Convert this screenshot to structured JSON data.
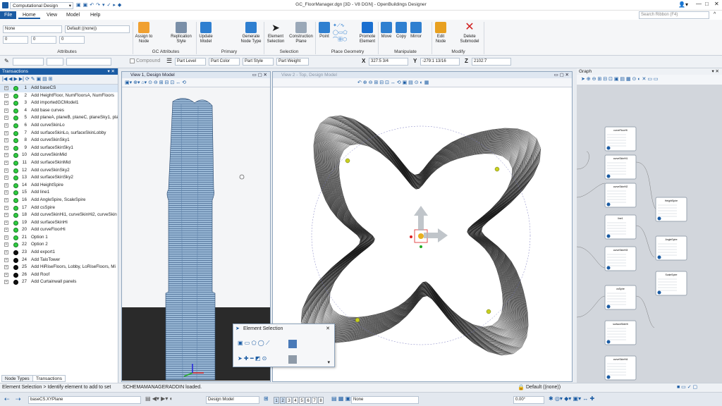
{
  "app": {
    "workspace": "Computational Design",
    "window_title": "GC_FloorManager.dgn [3D - V8 DGN] - OpenBuildings Designer",
    "search_placeholder": "Search Ribbon (F4)"
  },
  "menu": [
    "File",
    "Home",
    "View",
    "Model",
    "Help"
  ],
  "ribbon": {
    "attributes": {
      "level": "None",
      "style": "Default ((none))",
      "color": "0",
      "weight": "0",
      "linestyle": "0",
      "label": "Attributes"
    },
    "gc_attributes": {
      "assign": "Assign to Node",
      "replication": "Replication Style",
      "label": "GC Attributes"
    },
    "primary": {
      "update": "Update Model",
      "generate": "Generate Node Type",
      "label": "Primary"
    },
    "selection": {
      "element": "Element Selection",
      "construction": "Construction Plane",
      "label": "Selection"
    },
    "place_geometry": {
      "point": "Point",
      "promote": "Promote Element",
      "label": "Place Geometry"
    },
    "manipulate": {
      "move": "Move",
      "copy": "Copy",
      "mirror": "Mirror",
      "label": "Manipulate"
    },
    "modify": {
      "edit": "Edit Node",
      "delete": "Delete Submodel",
      "label": "Modify"
    }
  },
  "toolbar2": {
    "compound": "Compound",
    "part_level": "Part Level",
    "part_color": "Part Color",
    "part_style": "Part Style",
    "part_weight": "Part Weight",
    "x_label": "X",
    "x_value": "327:5 3/4",
    "y_label": "Y",
    "y_value": "-279:1 13/16",
    "z_label": "Z",
    "z_value": "2102:7"
  },
  "transactions": {
    "title": "Transactions",
    "rows": [
      {
        "n": "1",
        "t": "Add baseCS",
        "s": "g"
      },
      {
        "n": "2",
        "t": "Add HeightFloor, NumFloorsA, NumFloors",
        "s": "g"
      },
      {
        "n": "3",
        "t": "Add importedGCModel1",
        "s": "g"
      },
      {
        "n": "4",
        "t": "Add base curves",
        "s": "g"
      },
      {
        "n": "5",
        "t": "Add planeA, planeB, planeC, planeSky1, pla",
        "s": "g"
      },
      {
        "n": "6",
        "t": "Add curveSkinLo",
        "s": "g"
      },
      {
        "n": "7",
        "t": "Add surfaceSkinLo, surfaceSkinLobby",
        "s": "g"
      },
      {
        "n": "8",
        "t": "Add curveSkinSky1",
        "s": "g"
      },
      {
        "n": "9",
        "t": "Add surfaceSkinSky1",
        "s": "g"
      },
      {
        "n": "10",
        "t": "Add curveSkinMid",
        "s": "g"
      },
      {
        "n": "11",
        "t": "Add surfaceSkinMid",
        "s": "g"
      },
      {
        "n": "12",
        "t": "Add curveSkinSky2",
        "s": "g"
      },
      {
        "n": "13",
        "t": "Add surfaceSkinSky2",
        "s": "g"
      },
      {
        "n": "14",
        "t": "Add HeightSpire",
        "s": "g"
      },
      {
        "n": "15",
        "t": "Add line1",
        "s": "g"
      },
      {
        "n": "16",
        "t": "Add AngleSpire, ScaleSpire",
        "s": "g"
      },
      {
        "n": "17",
        "t": "Add csSpire",
        "s": "g"
      },
      {
        "n": "18",
        "t": "Add curveSkinHi1, curveSkinHi2, curveSkin",
        "s": "g"
      },
      {
        "n": "19",
        "t": "Add surfaceSkinHi",
        "s": "g"
      },
      {
        "n": "20",
        "t": "Add curveFloorHi",
        "s": "g"
      },
      {
        "n": "21",
        "t": "Option 1",
        "s": "g"
      },
      {
        "n": "22",
        "t": "Option 2",
        "s": "g"
      },
      {
        "n": "23",
        "t": "Add export1",
        "s": "b"
      },
      {
        "n": "24",
        "t": "Add TaloTower",
        "s": "b"
      },
      {
        "n": "25",
        "t": "Add HiRiseFloors, Lobby, LoRiseFloors, Mi",
        "s": "b"
      },
      {
        "n": "26",
        "t": "Add Roof",
        "s": "b"
      },
      {
        "n": "27",
        "t": "Add Curtainwall panels",
        "s": "b"
      }
    ],
    "tabs": [
      "Node Types",
      "Transactions"
    ]
  },
  "views": {
    "v1": "View 1, Design Model",
    "v2": "View 2 - Top, Design Model"
  },
  "graph": {
    "title": "Graph",
    "nodes": [
      "curveFloorHi",
      "curveSkinHi1",
      "curveSkinHi2",
      "HeightSpire",
      "line1",
      "AngleSpire",
      "curveSkinHi3",
      "ScaleSpire",
      "csSpire",
      "surfaceSkinHi",
      "curveSkinHi4"
    ]
  },
  "element_selection": {
    "title": "Element Selection"
  },
  "status": {
    "prompt": "Element Selection > Identify element to add to set",
    "message": "SCHEMAMANAGERADDIN loaded.",
    "style": "Default ((none))"
  },
  "bottom": {
    "acs": "baseCS.XYPlane",
    "model": "Design Model",
    "views": [
      "1",
      "2",
      "3",
      "4",
      "5",
      "6",
      "7",
      "8"
    ],
    "level": "None",
    "angle": "0.00°"
  }
}
